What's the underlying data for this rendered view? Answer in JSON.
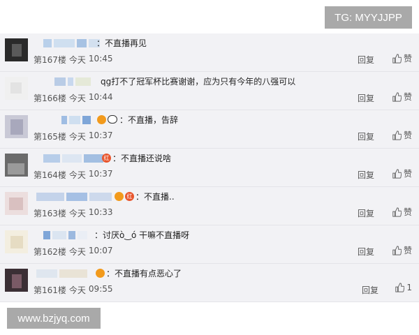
{
  "watermark_top": "TG: MYYJJPP",
  "watermark_bottom": "www.bzjyq.com",
  "comments": [
    {
      "text": "不直播再见",
      "floor": "第167楼",
      "day": "今天",
      "time": "10:45",
      "reply": "回复",
      "like_label": "赞"
    },
    {
      "text": "qg打不了冠军杯比赛谢谢，应为只有今年的八强可以",
      "floor": "第166楼",
      "day": "今天",
      "time": "10:44",
      "reply": "回复",
      "like_label": "赞"
    },
    {
      "text": "不直播，告辞",
      "floor": "第165楼",
      "day": "今天",
      "time": "10:37",
      "reply": "回复",
      "like_label": "赞"
    },
    {
      "text": "不直播还说啥",
      "floor": "第164楼",
      "day": "今天",
      "time": "10:37",
      "reply": "回复",
      "like_label": "赞"
    },
    {
      "text": "不直播..",
      "floor": "第163楼",
      "day": "今天",
      "time": "10:33",
      "reply": "回复",
      "like_label": "赞"
    },
    {
      "text": "讨厌ò‿ó 干嘛不直播呀",
      "floor": "第162楼",
      "day": "今天",
      "time": "10:07",
      "reply": "回复",
      "like_label": "赞"
    },
    {
      "text": "不直播有点恶心了",
      "floor": "第161楼",
      "day": "今天",
      "time": "09:55",
      "reply": "回复",
      "like_label": "1"
    }
  ],
  "badge_label": "红",
  "colon": "："
}
